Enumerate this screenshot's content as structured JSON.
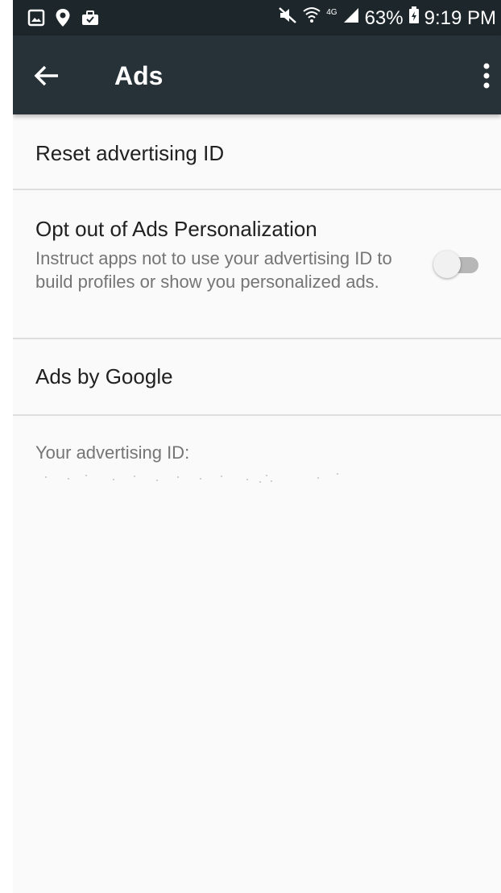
{
  "status_bar": {
    "battery": "63%",
    "time": "9:19 PM",
    "network_type": "4G",
    "left_icons": [
      "gallery-icon",
      "location-icon",
      "briefcase-icon"
    ],
    "right_icons": [
      "mute-icon",
      "wifi-icon",
      "signal-icon",
      "battery-icon"
    ]
  },
  "app_bar": {
    "title": "Ads",
    "icons": [
      "back-arrow-icon",
      "more-vert-icon"
    ],
    "colors": {
      "background": "#263238",
      "status_bar": "#1c262b"
    }
  },
  "settings": {
    "reset_label": "Reset advertising ID",
    "opt_out": {
      "title": "Opt out of Ads Personalization",
      "summary": "Instruct apps not to use your advertising ID to build profiles or show you personalized ads.",
      "toggle_on": false
    },
    "ads_by_google_label": "Ads by Google",
    "ad_id_label": "Your advertising ID:"
  }
}
